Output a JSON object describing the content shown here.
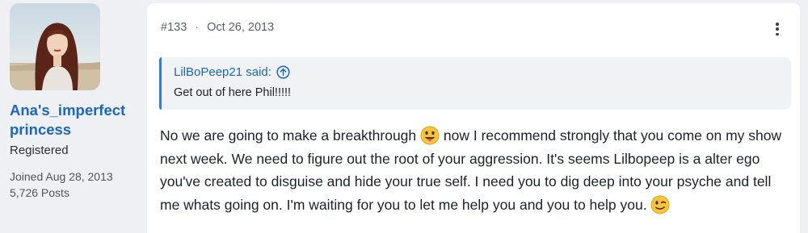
{
  "user": {
    "name": "Ana's_imperfect princess",
    "title": "Registered",
    "joined": "Joined Aug 28, 2013",
    "posts": "5,726 Posts"
  },
  "post": {
    "number": "#133",
    "separator": "·",
    "date": "Oct 26, 2013",
    "quote": {
      "author": "LilBoPeep21 said:",
      "text": "Get out of here Phil!!!!!"
    },
    "message": {
      "part1": "No we are going to make a breakthrough",
      "part2": " now I recommend strongly that you come on my show next week. We need to figure out the root of your aggression. It's seems Lilbopeep is a alter ego you've created to disguise and hide your true self. I need you to dig deep into your psyche and tell me whats going on. I'm waiting for you to let me help you and you to help you.",
      "emoji1": "tongue-out-emoji",
      "emoji2": "wink-emoji"
    }
  },
  "icons": {
    "menu": "vertical-ellipsis-icon",
    "quote_jump": "arrow-up-circle-icon"
  },
  "colors": {
    "link": "#1a66c9",
    "quote_border": "#2f7be0",
    "quote_bg": "#f1f2f4",
    "page_bg": "#eef0f3"
  }
}
